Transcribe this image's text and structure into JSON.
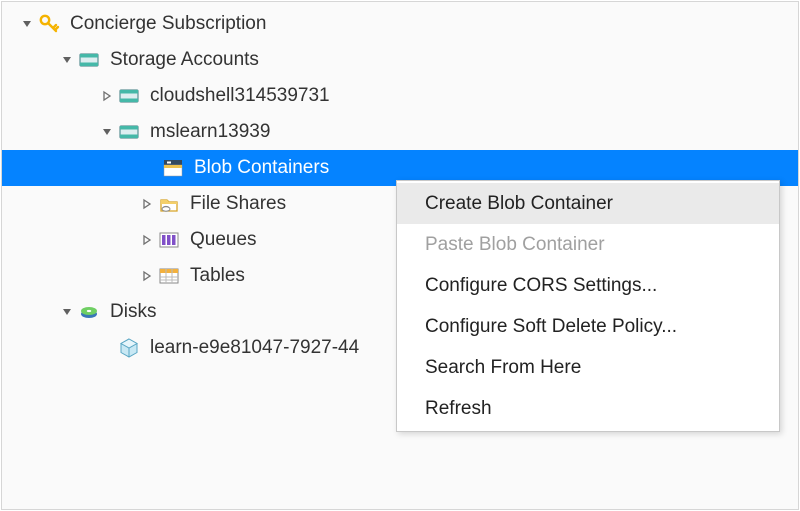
{
  "tree": {
    "subscription": "Concierge Subscription",
    "storage_accounts": "Storage Accounts",
    "acct_cloudshell": "cloudshell314539731",
    "acct_mslearn": "mslearn13939",
    "blob_containers": "Blob Containers",
    "file_shares": "File Shares",
    "queues": "Queues",
    "tables": "Tables",
    "disks": "Disks",
    "disk_learn": "learn-e9e81047-7927-44"
  },
  "context_menu": {
    "create": "Create Blob Container",
    "paste": "Paste Blob Container",
    "cors": "Configure CORS Settings...",
    "softdelete": "Configure Soft Delete Policy...",
    "search": "Search From Here",
    "refresh": "Refresh"
  }
}
